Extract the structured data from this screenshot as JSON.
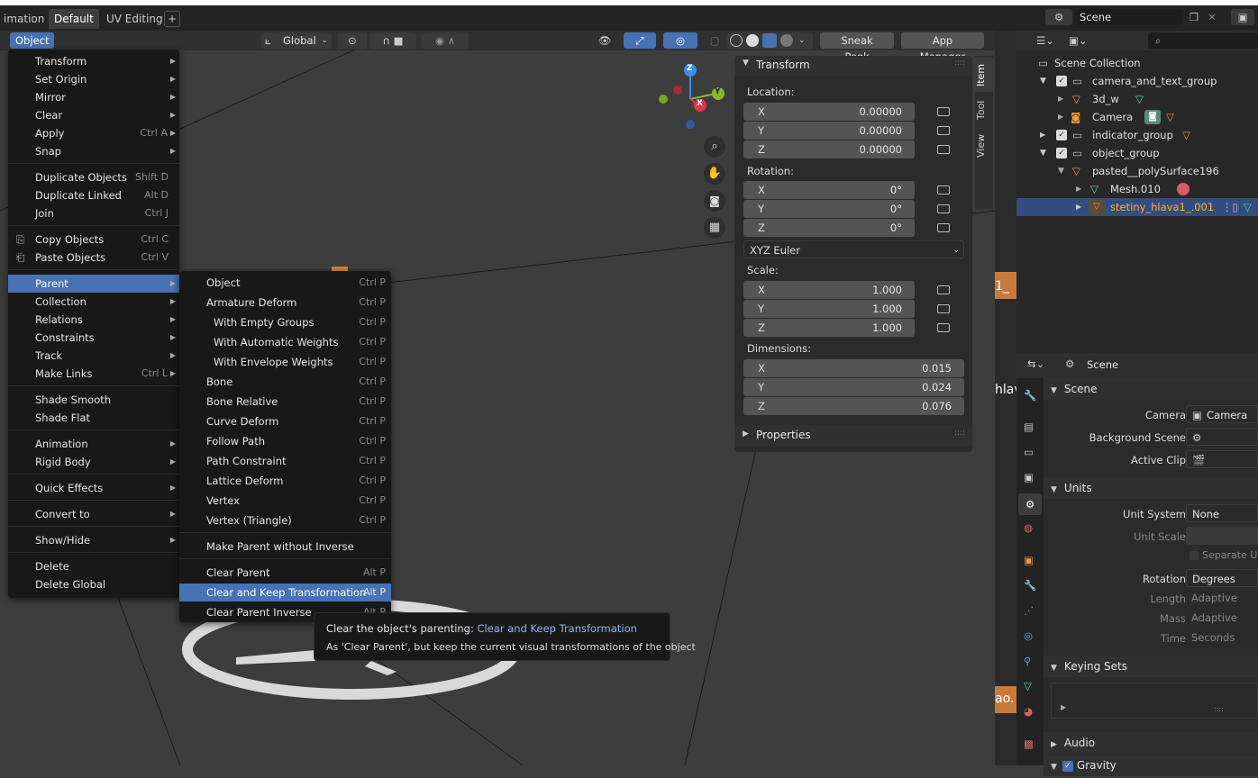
{
  "workspace_tabs": [
    "imation",
    "Default",
    "UV Editing",
    "+"
  ],
  "scene_name": "Scene",
  "header": {
    "object_menu": "Object",
    "orientation": "Global",
    "sneak_peek": "Sneak Peek",
    "app_manager": "App Manager"
  },
  "object_menu": [
    {
      "label": "Transform",
      "shortcut": "",
      "sub": true
    },
    {
      "label": "Set Origin",
      "shortcut": "",
      "sub": true
    },
    {
      "label": "Mirror",
      "shortcut": "",
      "sub": true
    },
    {
      "label": "Clear",
      "shortcut": "",
      "sub": true
    },
    {
      "label": "Apply",
      "shortcut": "Ctrl A",
      "sub": true
    },
    {
      "label": "Snap",
      "shortcut": "",
      "sub": true
    },
    {
      "label": "Duplicate Objects",
      "shortcut": "Shift D",
      "sub": false
    },
    {
      "label": "Duplicate Linked",
      "shortcut": "Alt D",
      "sub": false
    },
    {
      "label": "Join",
      "shortcut": "Ctrl J",
      "sub": false
    },
    {
      "label": "Copy Objects",
      "shortcut": "Ctrl C",
      "sub": false
    },
    {
      "label": "Paste Objects",
      "shortcut": "Ctrl V",
      "sub": false
    },
    {
      "label": "Parent",
      "shortcut": "",
      "sub": true
    },
    {
      "label": "Collection",
      "shortcut": "",
      "sub": true
    },
    {
      "label": "Relations",
      "shortcut": "",
      "sub": true
    },
    {
      "label": "Constraints",
      "shortcut": "",
      "sub": true
    },
    {
      "label": "Track",
      "shortcut": "",
      "sub": true
    },
    {
      "label": "Make Links",
      "shortcut": "Ctrl L",
      "sub": true
    },
    {
      "label": "Shade Smooth",
      "shortcut": "",
      "sub": false
    },
    {
      "label": "Shade Flat",
      "shortcut": "",
      "sub": false
    },
    {
      "label": "Animation",
      "shortcut": "",
      "sub": true
    },
    {
      "label": "Rigid Body",
      "shortcut": "",
      "sub": true
    },
    {
      "label": "Quick Effects",
      "shortcut": "",
      "sub": true
    },
    {
      "label": "Convert to",
      "shortcut": "",
      "sub": true
    },
    {
      "label": "Show/Hide",
      "shortcut": "",
      "sub": true
    },
    {
      "label": "Delete",
      "shortcut": "",
      "sub": false
    },
    {
      "label": "Delete Global",
      "shortcut": "",
      "sub": false
    }
  ],
  "parent_menu": [
    {
      "label": "Object",
      "shortcut": "Ctrl P"
    },
    {
      "label": "Armature Deform",
      "shortcut": "Ctrl P"
    },
    {
      "label": "With Empty Groups",
      "shortcut": "Ctrl P"
    },
    {
      "label": "With Automatic Weights",
      "shortcut": "Ctrl P"
    },
    {
      "label": "With Envelope Weights",
      "shortcut": "Ctrl P"
    },
    {
      "label": "Bone",
      "shortcut": "Ctrl P"
    },
    {
      "label": "Bone Relative",
      "shortcut": "Ctrl P"
    },
    {
      "label": "Curve Deform",
      "shortcut": "Ctrl P"
    },
    {
      "label": "Follow Path",
      "shortcut": "Ctrl P"
    },
    {
      "label": "Path Constraint",
      "shortcut": "Ctrl P"
    },
    {
      "label": "Lattice Deform",
      "shortcut": "Ctrl P"
    },
    {
      "label": "Vertex",
      "shortcut": "Ctrl P"
    },
    {
      "label": "Vertex (Triangle)",
      "shortcut": "Ctrl P"
    },
    {
      "label": "Make Parent without Inverse",
      "shortcut": ""
    },
    {
      "label": "Clear Parent",
      "shortcut": "Alt P"
    },
    {
      "label": "Clear and Keep Transformation",
      "shortcut": "Alt P"
    },
    {
      "label": "Clear Parent Inverse",
      "shortcut": "Alt P"
    }
  ],
  "tooltip": {
    "title": "Clear the object's parenting:",
    "op": "Clear and Keep Transformation",
    "desc": "As 'Clear Parent', but keep the current visual transformations of the object"
  },
  "transform": {
    "header": "Transform",
    "location_label": "Location:",
    "location": [
      "0.00000",
      "0.00000",
      "0.00000"
    ],
    "rotation_label": "Rotation:",
    "rotation": [
      "0°",
      "0°",
      "0°"
    ],
    "rotation_mode": "XYZ Euler",
    "scale_label": "Scale:",
    "scale": [
      "1.000",
      "1.000",
      "1.000"
    ],
    "dimensions_label": "Dimensions:",
    "dimensions": [
      "0.015",
      "0.024",
      "0.076"
    ],
    "properties": "Properties",
    "axes": [
      "X",
      "Y",
      "Z"
    ]
  },
  "side_tabs": [
    "Item",
    "Tool",
    "View"
  ],
  "outliner": [
    {
      "label": "Scene Collection"
    },
    {
      "label": "camera_and_text_group"
    },
    {
      "label": "3d_w"
    },
    {
      "label": "Camera"
    },
    {
      "label": "indicator_group"
    },
    {
      "label": "object_group"
    },
    {
      "label": "pasted__polySurface196"
    },
    {
      "label": "Mesh.010"
    },
    {
      "label": "stetiny_hlava1_.001"
    }
  ],
  "properties": {
    "breadcrumb": "Scene",
    "scene_section": "Scene",
    "camera_label": "Camera",
    "camera_value": "Camera",
    "bg_scene_label": "Background Scene",
    "active_clip_label": "Active Clip",
    "units_section": "Units",
    "unit_system_label": "Unit System",
    "unit_system_value": "None",
    "unit_scale_label": "Unit Scale",
    "separate_units": "Separate Uni",
    "rotation_label": "Rotation",
    "rotation_value": "Degrees",
    "length_label": "Length",
    "length_value": "Adaptive",
    "mass_label": "Mass",
    "mass_value": "Adaptive",
    "time_label": "Time",
    "time_value": "Seconds",
    "keying_sets": "Keying Sets",
    "audio": "Audio",
    "gravity": "Gravity"
  },
  "gizmo_axes": [
    "Z",
    "Y",
    "X"
  ],
  "partial_labels": [
    "1_",
    "hlav",
    "ao."
  ],
  "colors": {
    "accent": "#4772b3",
    "selected_text": "#ffaf29"
  }
}
